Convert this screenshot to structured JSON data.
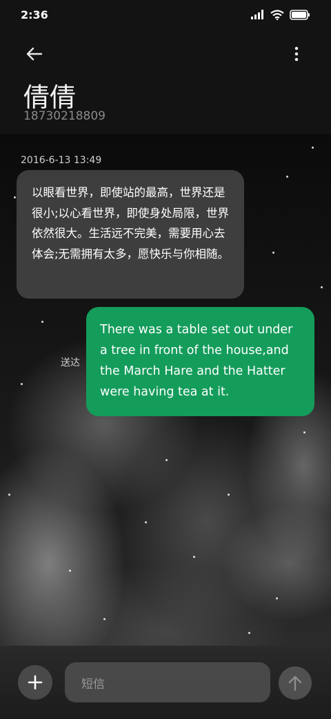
{
  "status_bar": {
    "time": "2:36"
  },
  "contact": {
    "name": "倩倩",
    "number": "18730218809"
  },
  "messages": {
    "timestamp": "2016-6-13 13:49",
    "incoming_text": "以眼看世界，即使站的最高，世界还是很小;以心看世界，即使身处局限，世界依然很大。生活远不完美，需要用心去体会;无需拥有太多，愿快乐与你相随。",
    "outgoing_text": "There was a table set out under a tree in front of the house,and the March Hare and the Hatter were having tea at it.",
    "outgoing_status": "送达"
  },
  "composer": {
    "placeholder": "短信"
  },
  "colors": {
    "outgoing_bubble": "#149c5b",
    "incoming_bubble": "#464646",
    "background": "#131313"
  },
  "icons": [
    "back-arrow-icon",
    "more-vertical-icon",
    "plus-icon",
    "send-arrow-icon",
    "signal-icon",
    "wifi-icon",
    "battery-icon"
  ]
}
